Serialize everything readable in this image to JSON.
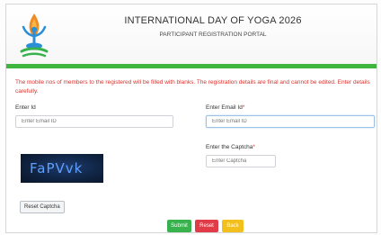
{
  "header": {
    "title": "INTERNATIONAL DAY OF YOGA 2026",
    "subtitle": "PARTICIPANT REGISTRATION PORTAL",
    "logo_icon": "yoga-pose-logo-icon"
  },
  "notice": "The mobile nos of members to the registered will be filled with blanks. The registration details are final and cannot be edited. Enter details carefully.",
  "form": {
    "email_id_label": "Enter Id",
    "email_id_placeholder": "Enter Email ID",
    "email_label": "Enter Email Id",
    "email_placeholder": "Enter Email ID",
    "captcha_label": "Enter the Captcha",
    "captcha_placeholder": "Enter Captcha",
    "captcha_text": "FaPVvk",
    "refresh_label": "Reset Captcha"
  },
  "buttons": {
    "submit": "Submit",
    "reset": "Reset",
    "back": "Back"
  },
  "colors": {
    "accent_green": "#3fb53f",
    "notice_red": "#d9332d",
    "submit": "#37b24d",
    "reset": "#e03b46",
    "back": "#f2bf1d"
  }
}
